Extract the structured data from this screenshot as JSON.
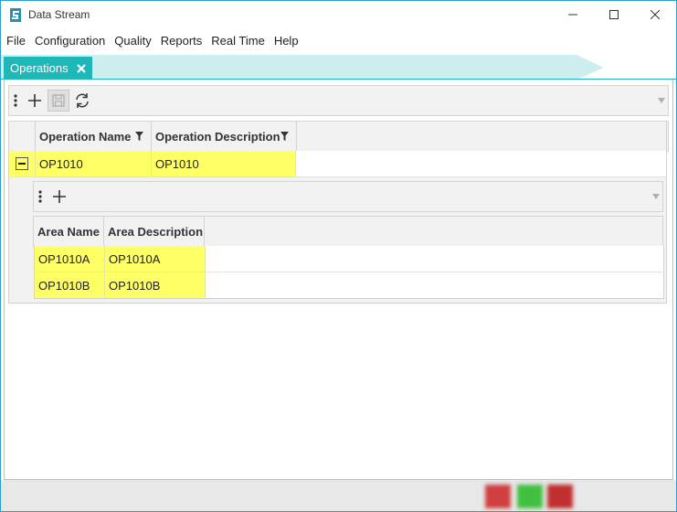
{
  "window": {
    "title": "Data Stream"
  },
  "menu": [
    "File",
    "Configuration",
    "Quality",
    "Reports",
    "Real Time",
    "Help"
  ],
  "tab": {
    "label": "Operations"
  },
  "operations_grid": {
    "columns": [
      "Operation Name",
      "Operation Description"
    ],
    "rows": [
      {
        "name": "OP1010",
        "description": "OP1010",
        "expanded": true
      }
    ]
  },
  "areas_grid": {
    "columns": [
      "Area Name",
      "Area Description"
    ],
    "rows": [
      {
        "name": "OP1010A",
        "description": "OP1010A"
      },
      {
        "name": "OP1010B",
        "description": "OP1010B"
      }
    ]
  },
  "colors": {
    "tab_accent": "#1fb8b8",
    "tab_strip_light": "#cdeff0",
    "highlight": "#ffff66",
    "status_red": "#d04040",
    "status_green": "#40c040"
  },
  "icons": [
    "app-logo-icon",
    "minimize-icon",
    "maximize-icon",
    "close-icon",
    "tab-close-icon",
    "kebab-menu-icon",
    "add-icon",
    "save-icon",
    "refresh-icon",
    "filter-icon",
    "collapse-icon",
    "dropdown-arrow-icon"
  ]
}
